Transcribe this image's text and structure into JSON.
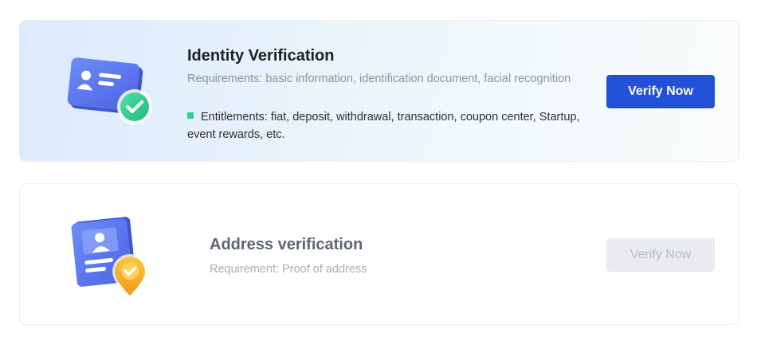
{
  "identity": {
    "title": "Identity Verification",
    "requirements": "Requirements: basic information, identification document, facial recognition",
    "entitlements": "Entitlements: fiat, deposit, withdrawal, transaction, coupon center, Startup, event rewards, etc.",
    "button_label": "Verify Now",
    "icon": "id-card-check-icon"
  },
  "address": {
    "title": "Address verification",
    "requirements": "Requirement: Proof of address",
    "button_label": "Verify Now",
    "button_disabled": true,
    "icon": "address-document-pin-icon"
  },
  "colors": {
    "primary": "#2251d8",
    "success": "#2ecf8f",
    "badge_orange": "#f7a823",
    "card_blue": "#5a7bf0"
  }
}
